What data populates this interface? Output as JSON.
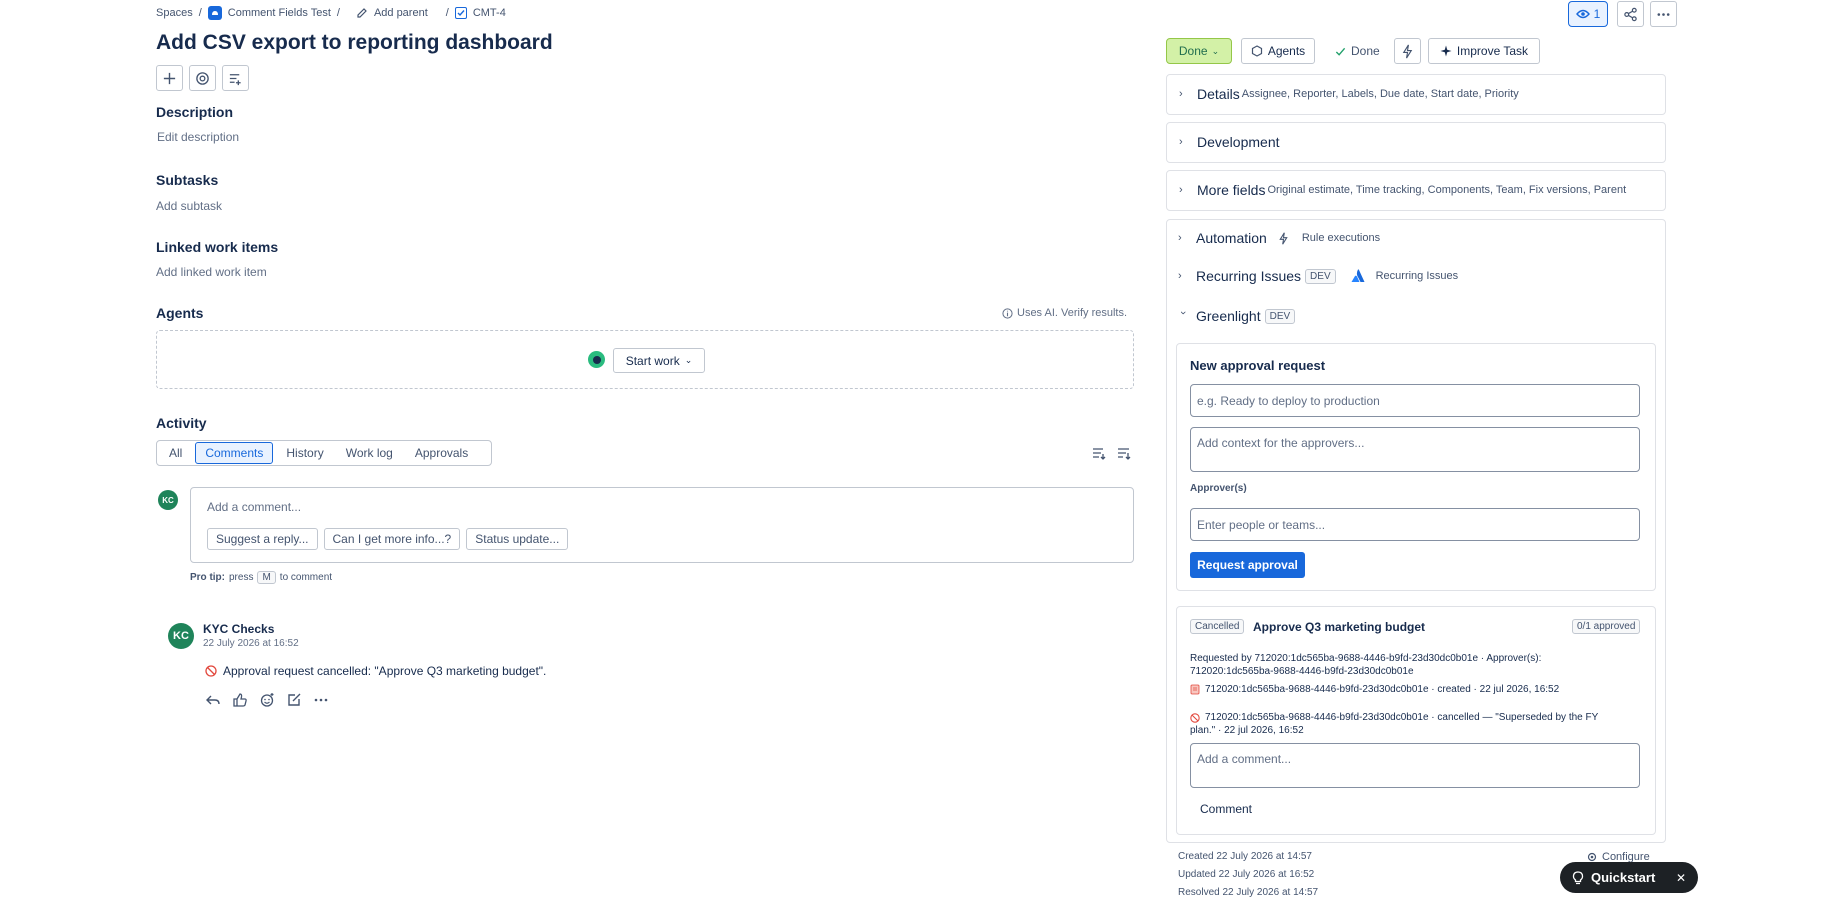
{
  "breadcrumb": {
    "spaces": "Spaces",
    "sep": "/",
    "project": "Comment Fields Test",
    "add_parent": "Add parent",
    "issue_key": "CMT-4"
  },
  "issue": {
    "title": "Add CSV export to reporting dashboard"
  },
  "top_actions": {
    "watch_count": "1"
  },
  "description": {
    "title": "Description",
    "placeholder": "Edit description"
  },
  "subtasks": {
    "title": "Subtasks",
    "action": "Add subtask"
  },
  "linked": {
    "title": "Linked work items",
    "action": "Add linked work item"
  },
  "agents": {
    "title": "Agents",
    "ai_note": "Uses AI. Verify results.",
    "start_work": "Start work"
  },
  "activity": {
    "title": "Activity",
    "tabs": [
      "All",
      "Comments",
      "History",
      "Work log",
      "Approvals"
    ],
    "active_tab": "Comments",
    "comment_placeholder": "Add a comment...",
    "suggestions": [
      "Suggest a reply...",
      "Can I get more info...?",
      "Status update..."
    ],
    "pro_tip_label": "Pro tip:",
    "pro_tip_press": "press",
    "pro_tip_key": "M",
    "pro_tip_rest": "to comment",
    "user_initials": "KC"
  },
  "comment": {
    "initials": "KC",
    "author": "KYC Checks",
    "time": "22 July 2026 at 16:52",
    "text": "Approval request cancelled: \"Approve Q3 marketing budget\"."
  },
  "status_bar": {
    "status_button": "Done",
    "agents": "Agents",
    "resolution": "Done",
    "improve": "Improve Task"
  },
  "panels": {
    "details": {
      "title": "Details",
      "sub": "Assignee, Reporter, Labels, Due date, Start date, Priority"
    },
    "development": {
      "title": "Development"
    },
    "more_fields": {
      "title": "More fields",
      "sub": "Original estimate, Time tracking, Components, Team, Fix versions, Parent"
    },
    "automation": {
      "title": "Automation",
      "sub": "Rule executions"
    },
    "recurring": {
      "title": "Recurring Issues",
      "tag": "DEV",
      "sub": "Recurring Issues"
    },
    "greenlight": {
      "title": "Greenlight",
      "tag": "DEV"
    }
  },
  "approval_form": {
    "title": "New approval request",
    "title_placeholder": "e.g. Ready to deploy to production",
    "context_placeholder": "Add context for the approvers...",
    "approvers_label": "Approver(s)",
    "approvers_placeholder": "Enter people or teams...",
    "submit": "Request approval"
  },
  "approval_card": {
    "status": "Cancelled",
    "title": "Approve Q3 marketing budget",
    "count": "0/1 approved",
    "requested_line1": "Requested by 712020:1dc565ba-9688-4446-b9fd-23d30dc0b01e · Approver(s):",
    "requested_line2": "712020:1dc565ba-9688-4446-b9fd-23d30dc0b01e",
    "event1": "712020:1dc565ba-9688-4446-b9fd-23d30dc0b01e · created · 22 jul 2026, 16:52",
    "event2_line1": "712020:1dc565ba-9688-4446-b9fd-23d30dc0b01e · cancelled — \"Superseded by the FY",
    "event2_line2": "plan.\" · 22 jul 2026, 16:52",
    "comment_placeholder": "Add a comment...",
    "comment_button": "Comment"
  },
  "meta": {
    "created": "Created 22 July 2026 at 14:57",
    "updated": "Updated 22 July 2026 at 16:52",
    "resolved": "Resolved 22 July 2026 at 14:57",
    "configure": "Configure"
  },
  "quickstart": {
    "label": "Quickstart"
  },
  "colors": {
    "primary": "#1868db",
    "done_green": "#d3f1a7",
    "avatar_green": "#1f845a"
  }
}
